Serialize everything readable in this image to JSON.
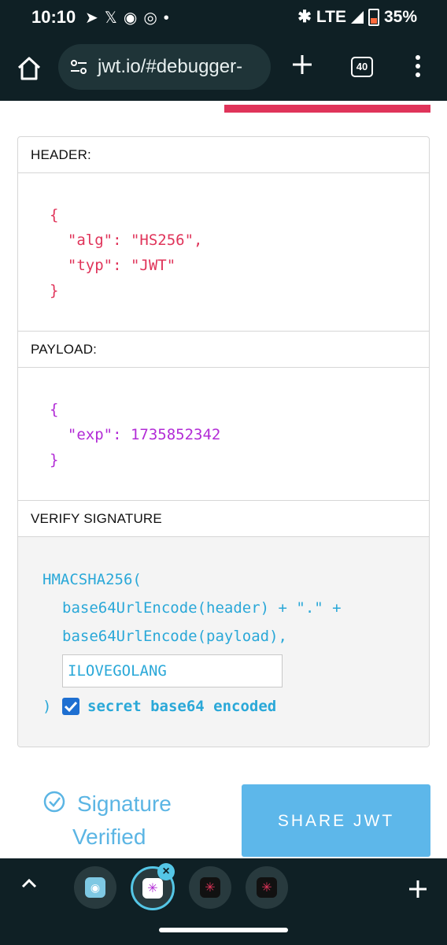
{
  "status_bar": {
    "time": "10:10",
    "network": "LTE",
    "battery": "35%"
  },
  "browser": {
    "url": "jwt.io/#debugger-",
    "tab_count": "40"
  },
  "header_section": {
    "title": "HEADER:",
    "lines": [
      "{",
      "  \"alg\": \"HS256\",",
      "  \"typ\": \"JWT\"",
      "}"
    ]
  },
  "payload_section": {
    "title": "PAYLOAD:",
    "lines": [
      "{",
      "  \"exp\": 1735852342",
      "}"
    ]
  },
  "signature_section": {
    "title": "VERIFY SIGNATURE",
    "line1": "HMACSHA256(",
    "line2": "base64UrlEncode(header) + \".\" +",
    "line3": "base64UrlEncode(payload),",
    "secret_value": "ILOVEGOLANG",
    "close_paren": ")",
    "checkbox_label": "secret base64 encoded",
    "checkbox_checked": true
  },
  "result": {
    "verified_line1": "Signature",
    "verified_line2": "Verified",
    "share_label": "SHARE JWT"
  },
  "colors": {
    "header_json": "#e0345a",
    "payload_json": "#b22bd6",
    "signature_text": "#2aa8d8",
    "accent_bar": "#e0345a",
    "share_button": "#5db7ea"
  }
}
